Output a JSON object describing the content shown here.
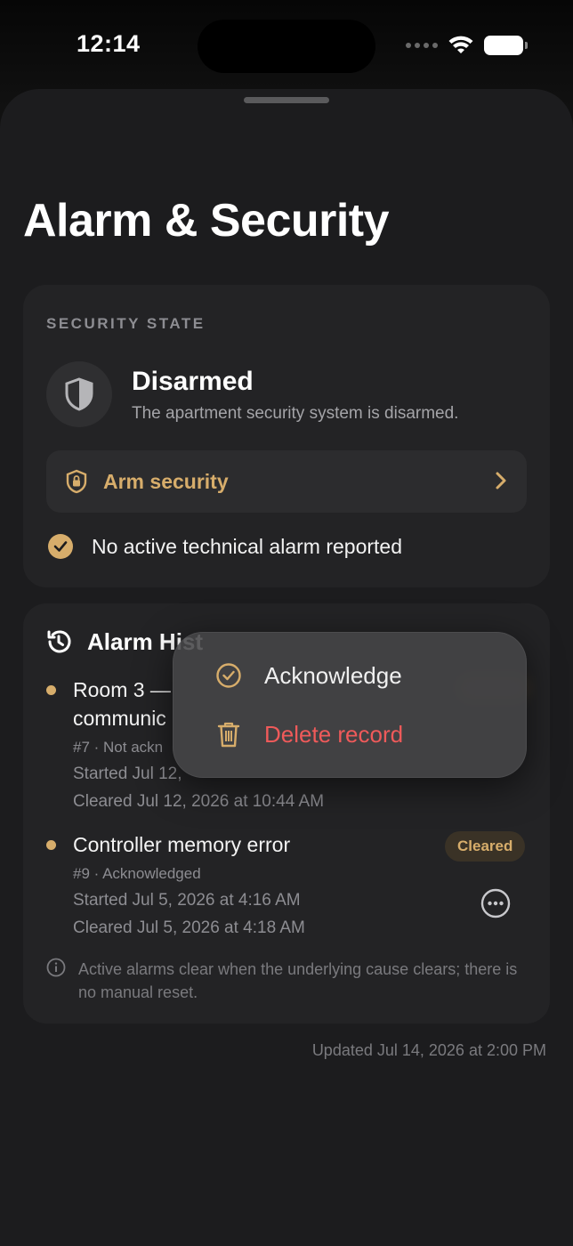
{
  "status_bar": {
    "time": "12:14"
  },
  "page": {
    "title": "Alarm & Security"
  },
  "security": {
    "section_label": "SECURITY STATE",
    "state_title": "Disarmed",
    "state_subtitle": "The apartment security system is disarmed.",
    "arm_button_label": "Arm security",
    "technical_status": "No active technical alarm reported"
  },
  "history": {
    "title": "Alarm History",
    "title_visible": "Alarm Hist",
    "alarms": [
      {
        "title_line1": "Room 3 —",
        "title_line2": "communic",
        "meta": "#7 · Not ackn",
        "started": "Started Jul 12, 2026 at 10:4x AM",
        "started_visible": "Started Jul 12,",
        "cleared": "Cleared Jul 12, 2026 at 10:44 AM"
      },
      {
        "title": "Controller memory error",
        "badge": "Cleared",
        "meta": "#9 · Acknowledged",
        "started": "Started Jul 5, 2026 at 4:16 AM",
        "cleared": "Cleared Jul 5, 2026 at 4:18 AM"
      }
    ],
    "info_note": "Active alarms clear when the underlying cause clears; there is no manual reset."
  },
  "footer": {
    "updated": "Updated Jul 14, 2026 at 2:00 PM"
  },
  "context_menu": {
    "items": [
      {
        "label": "Acknowledge",
        "icon": "checkmark-circle-icon"
      },
      {
        "label": "Delete record",
        "icon": "trash-icon"
      }
    ]
  },
  "colors": {
    "accent_gold": "#d7ad6b",
    "destructive_red": "#ef5a5a",
    "sheet_background": "#1c1c1e",
    "card_background": "#232325"
  }
}
